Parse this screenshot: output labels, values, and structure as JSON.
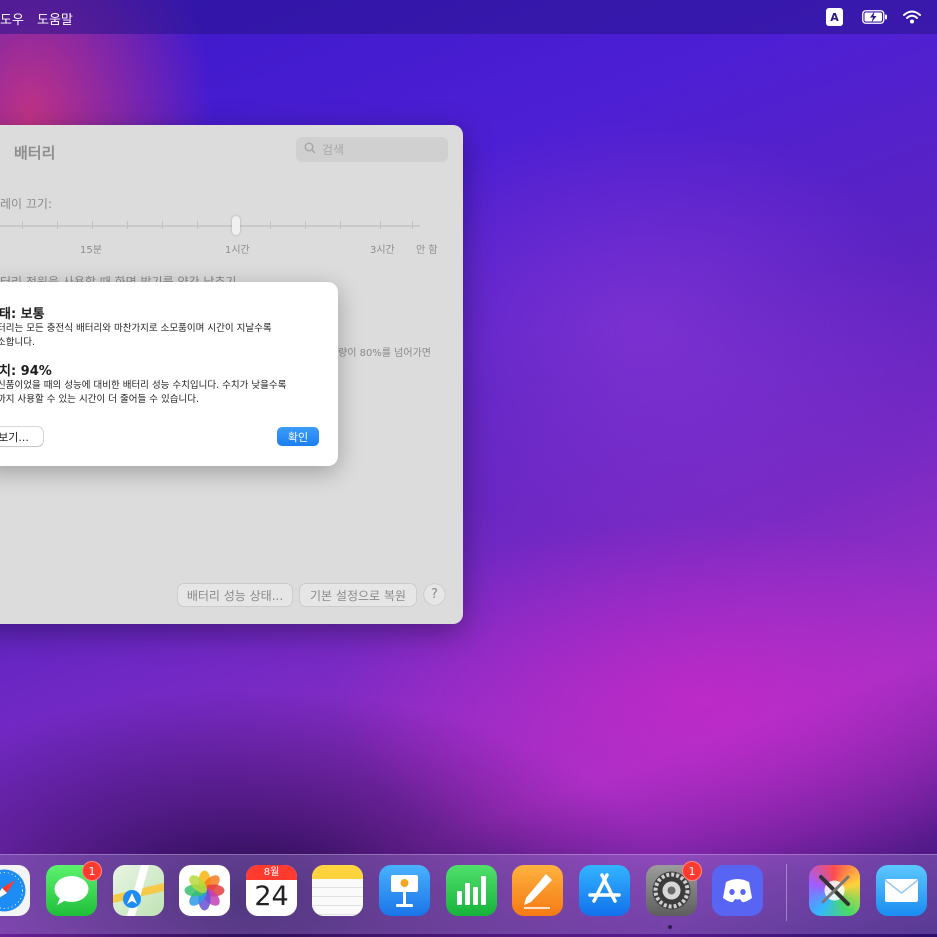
{
  "menubar": {
    "items": [
      "도우",
      "도움말"
    ],
    "status_icons": [
      "keyboard-input-icon",
      "battery-charging-icon",
      "wifi-icon"
    ],
    "input_source": "A"
  },
  "window": {
    "title": "배터리",
    "search_placeholder": "검색",
    "display_off_label": "레이 끄기:",
    "slider_ticks": [
      "15분",
      "1시간",
      "3시간",
      "안 함"
    ],
    "option_text": "터리 전원을 사용할 때 화면 밝기를 약간 낮추기",
    "side_text": "량이 80%를 넘어가면",
    "battery_health_button": "배터리 성능 상태...",
    "restore_defaults_button": "기본 설정으로 복원",
    "help_button": "?"
  },
  "sheet": {
    "status_heading": "태: 보통",
    "status_line1": "터리는 모든 충전식 배터리와 마찬가지로 소모품이며 시간이 지날수록",
    "status_line2": "소합니다.",
    "capacity_heading": "치: 94%",
    "capacity_line1": "신품이었을 때의 성능에 대비한 배터리 성능 수치입니다. 수치가 낮을수록",
    "capacity_line2": "까지 사용할 수 있는 시간이 더 줄어들 수 있습니다.",
    "more_button": "보기...",
    "ok_button": "확인"
  },
  "dock": {
    "apps": [
      {
        "name": "Safari",
        "icon": "safari-icon"
      },
      {
        "name": "Messages",
        "icon": "messages-icon",
        "badge": "1"
      },
      {
        "name": "Maps",
        "icon": "maps-icon"
      },
      {
        "name": "Photos",
        "icon": "photos-icon"
      },
      {
        "name": "Calendar",
        "icon": "calendar-icon",
        "month": "8월",
        "day": "24"
      },
      {
        "name": "Notes",
        "icon": "notes-icon"
      },
      {
        "name": "Keynote",
        "icon": "keynote-icon"
      },
      {
        "name": "Numbers",
        "icon": "numbers-icon"
      },
      {
        "name": "Pages",
        "icon": "pages-icon"
      },
      {
        "name": "App Store",
        "icon": "app-store-icon"
      },
      {
        "name": "System Preferences",
        "icon": "system-preferences-icon",
        "badge": "1"
      },
      {
        "name": "Discord",
        "icon": "discord-icon"
      },
      {
        "name": "ColorSync Utility",
        "icon": "colorsync-utility-icon"
      },
      {
        "name": "Mail",
        "icon": "mail-icon"
      }
    ]
  }
}
